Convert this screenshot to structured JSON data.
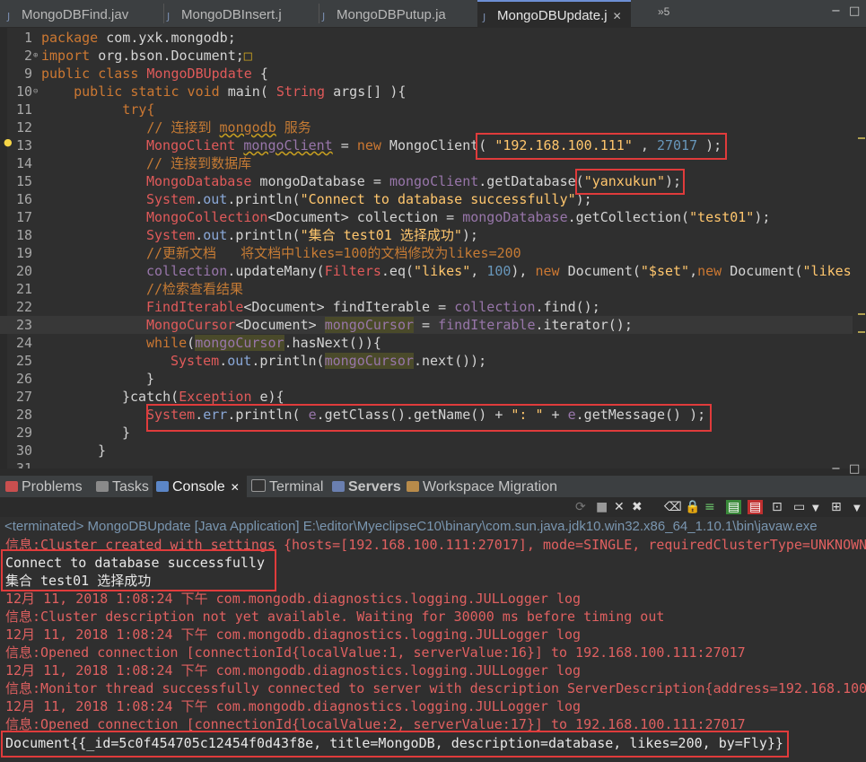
{
  "editor_tabs": [
    {
      "label": "MongoDBFind.jav"
    },
    {
      "label": "MongoDBInsert.j"
    },
    {
      "label": "MongoDBPutup.ja"
    },
    {
      "label": "MongoDBUpdate.j",
      "active": true,
      "close": "✕"
    }
  ],
  "tab_overflow": "»5",
  "window_controls": {
    "minimize": "−",
    "maximize": "□"
  },
  "code_lines": [
    {
      "num": "1"
    },
    {
      "num": "2"
    },
    {
      "num": "9"
    },
    {
      "num": "10"
    },
    {
      "num": "11"
    },
    {
      "num": "12"
    },
    {
      "num": "13"
    },
    {
      "num": "14"
    },
    {
      "num": "15"
    },
    {
      "num": "16"
    },
    {
      "num": "17"
    },
    {
      "num": "18"
    },
    {
      "num": "19"
    },
    {
      "num": "20"
    },
    {
      "num": "21"
    },
    {
      "num": "22"
    },
    {
      "num": "23"
    },
    {
      "num": "24"
    },
    {
      "num": "25"
    },
    {
      "num": "26"
    },
    {
      "num": "27"
    },
    {
      "num": "28"
    },
    {
      "num": "29"
    },
    {
      "num": "30"
    },
    {
      "num": "31"
    }
  ],
  "code": {
    "l1": [
      "package",
      " com.yxk.mongodb;"
    ],
    "l2": [
      "import",
      " org.bson.Document;",
      "□"
    ],
    "l9": [
      "public class ",
      "MongoDBUpdate",
      " {"
    ],
    "l10": [
      "    public static void ",
      "main( ",
      "String",
      " args[] ){"
    ],
    "l11": [
      "          try{"
    ],
    "l12": [
      "             // 连接到 ",
      "mongodb",
      " 服务"
    ],
    "l13": [
      "MongoClient",
      " ",
      "mongoClient",
      " = ",
      "new",
      " MongoClient( ",
      "\"192.168.100.111\"",
      " , ",
      "27017",
      " );"
    ],
    "l14": [
      "// 连接到数据库"
    ],
    "l15": [
      "MongoDatabase",
      " mongoDatabase = ",
      "mongoClient",
      ".getDatabase(",
      "\"yanxukun\"",
      ");"
    ],
    "l16": [
      "System",
      ".",
      "out",
      ".println(",
      "\"Connect to database successfully\"",
      ");"
    ],
    "l17": [
      "MongoCollection",
      "<Document> collection = ",
      "mongoDatabase",
      ".getCollection(",
      "\"test01\"",
      ");"
    ],
    "l18": [
      "System",
      ".",
      "out",
      ".println(",
      "\"集合 test01 选择成功\"",
      ");"
    ],
    "l19": [
      "//更新文档   将文档中likes=100的文档修改为likes=200"
    ],
    "l20": [
      "collection",
      ".updateMany(",
      "Filters",
      ".eq(",
      "\"likes\"",
      ", ",
      "100",
      "), ",
      "new",
      " Document(",
      "\"$set\"",
      ",",
      "new",
      " Document(",
      "\"likes"
    ],
    "l21": [
      "//检索查看结果"
    ],
    "l22": [
      "FindIterable",
      "<Document> findIterable = ",
      "collection",
      ".find();"
    ],
    "l23": [
      "MongoCursor",
      "<Document> ",
      "mongoCursor",
      " = ",
      "findIterable",
      ".iterator();"
    ],
    "l24": [
      "while",
      "(",
      "mongoCursor",
      ".hasNext()){"
    ],
    "l25": [
      "System",
      ".",
      "out",
      ".println(",
      "mongoCursor",
      ".next());"
    ],
    "l26": [
      "}"
    ],
    "l27": [
      "}catch(",
      "Exception",
      " e){"
    ],
    "l28": [
      "System",
      ".",
      "err",
      ".println( ",
      "e",
      ".getClass().getName() + ",
      "\": \"",
      " + ",
      "e",
      ".getMessage() );"
    ],
    "l29": [
      "}"
    ],
    "l30": [
      "}"
    ]
  },
  "view_tabs": [
    {
      "label": "Problems"
    },
    {
      "label": "Tasks"
    },
    {
      "label": "Console",
      "active": true,
      "close": "✕"
    },
    {
      "label": "Terminal"
    },
    {
      "label": "Servers"
    },
    {
      "label": "Workspace Migration"
    }
  ],
  "console_status": "<terminated> MongoDBUpdate [Java Application] E:\\editor\\MyeclipseC10\\binary\\com.sun.java.jdk10.win32.x86_64_1.10.1\\bin\\javaw.exe",
  "console_lines": [
    {
      "kind": "info",
      "text": "信息:Cluster created with settings {hosts=[192.168.100.111:27017], mode=SINGLE, requiredClusterType=UNKNOWN"
    },
    {
      "kind": "out",
      "text": "Connect to database successfully"
    },
    {
      "kind": "out",
      "text": "集合 test01 选择成功"
    },
    {
      "kind": "info",
      "text": "12月 11, 2018 1:08:24 下午 com.mongodb.diagnostics.logging.JULLogger log"
    },
    {
      "kind": "info",
      "text": "信息:Cluster description not yet available. Waiting for 30000 ms before timing out"
    },
    {
      "kind": "info",
      "text": "12月 11, 2018 1:08:24 下午 com.mongodb.diagnostics.logging.JULLogger log"
    },
    {
      "kind": "info",
      "text": "信息:Opened connection [connectionId{localValue:1, serverValue:16}] to 192.168.100.111:27017"
    },
    {
      "kind": "info",
      "text": "12月 11, 2018 1:08:24 下午 com.mongodb.diagnostics.logging.JULLogger log"
    },
    {
      "kind": "info",
      "text": "信息:Monitor thread successfully connected to server with description ServerDescription{address=192.168.100"
    },
    {
      "kind": "info",
      "text": "12月 11, 2018 1:08:24 下午 com.mongodb.diagnostics.logging.JULLogger log"
    },
    {
      "kind": "info",
      "text": "信息:Opened connection [connectionId{localValue:2, serverValue:17}] to 192.168.100.111:27017"
    },
    {
      "kind": "out",
      "text": "Document{{_id=5c0f454705c12454f0d43f8e, title=MongoDB, description=database, likes=200, by=Fly}}"
    }
  ],
  "colors": {
    "editor_bg": "#2f2f2f",
    "annotation_box": "#e03b3b",
    "keyword": "#cc7832",
    "string": "#ffc66d",
    "type": "#e05a5a",
    "console_info": "#e06060"
  },
  "icons": {
    "lightbulb": "lightbulb-warning-icon",
    "java_file": "java-file-icon"
  }
}
